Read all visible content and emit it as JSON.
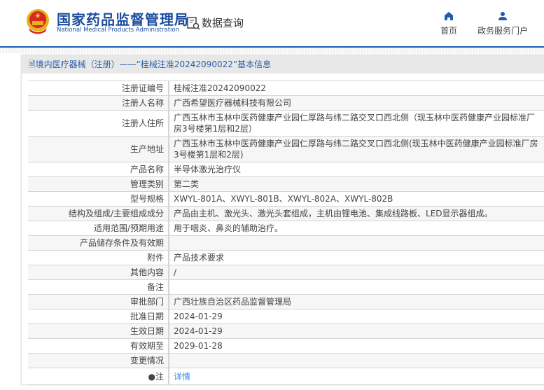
{
  "header": {
    "logo_cn": "国家药品监督管理局",
    "logo_en": "National Medical Products Administration",
    "query_label": "数据查询",
    "nav": [
      {
        "label": "首页",
        "icon": "home-icon"
      },
      {
        "label": "政务服务门户",
        "icon": "user-icon"
      }
    ]
  },
  "panel": {
    "title": "境内医疗器械（注册）——“桂械注准20242090022”基本信息"
  },
  "colors": {
    "brand": "#1c4e9e",
    "link": "#3a8ee6"
  },
  "rows": [
    {
      "label": "注册证编号",
      "value": "桂械注准20242090022"
    },
    {
      "label": "注册人名称",
      "value": "广西希望医疗器械科技有限公司"
    },
    {
      "label": "注册人住所",
      "value": "广西玉林市玉林中医药健康产业园仁厚路与纬二路交叉口西北侧（现玉林中医药健康产业园标准厂房3号楼第1层和2层）"
    },
    {
      "label": "生产地址",
      "value": "广西玉林市玉林中医药健康产业园仁厚路与纬二路交叉口西北侧(现玉林中医药健康产业园标准厂房3号楼第1层和2层)"
    },
    {
      "label": "产品名称",
      "value": "半导体激光治疗仪"
    },
    {
      "label": "管理类别",
      "value": "第二类"
    },
    {
      "label": "型号规格",
      "value": "XWYL-801A、XWYL-801B、XWYL-802A、XWYL-802B"
    },
    {
      "label": "结构及组成/主要组成成分",
      "value": "产品由主机、激光头、激光头套组成，主机由锂电池、集成线路板、LED显示器组成。"
    },
    {
      "label": "适用范围/预期用途",
      "value": "用于咽炎、鼻炎的辅助治疗。"
    },
    {
      "label": "产品储存条件及有效期",
      "value": ""
    },
    {
      "label": "附件",
      "value": "产品技术要求"
    },
    {
      "label": "其他内容",
      "value": "/"
    },
    {
      "label": "备注",
      "value": ""
    },
    {
      "label": "审批部门",
      "value": "广西壮族自治区药品监督管理局"
    },
    {
      "label": "批准日期",
      "value": "2024-01-29"
    },
    {
      "label": "生效日期",
      "value": "2024-01-29"
    },
    {
      "label": "有效期至",
      "value": "2029-01-28"
    },
    {
      "label": "变更情况",
      "value": ""
    }
  ],
  "note": {
    "label": "注",
    "link": "详情"
  }
}
